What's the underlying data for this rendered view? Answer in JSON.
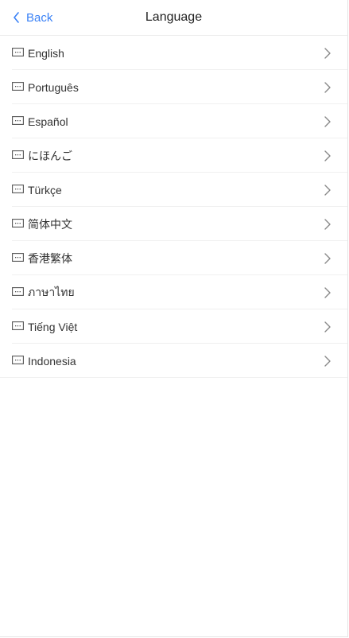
{
  "header": {
    "back_label": "Back",
    "title": "Language"
  },
  "colors": {
    "accent": "#3b82f6",
    "text": "#333333",
    "divider": "#f0f0f0",
    "chevron": "#888888"
  },
  "languages": [
    {
      "label": "English",
      "icon": "message-icon"
    },
    {
      "label": "Português",
      "icon": "message-icon"
    },
    {
      "label": "Español",
      "icon": "message-icon"
    },
    {
      "label": "にほんご",
      "icon": "message-icon"
    },
    {
      "label": "Türkçe",
      "icon": "message-icon"
    },
    {
      "label": "简体中文",
      "icon": "message-icon"
    },
    {
      "label": "香港繁体",
      "icon": "message-icon"
    },
    {
      "label": "ภาษาไทย",
      "icon": "message-icon"
    },
    {
      "label": "Tiếng Việt",
      "icon": "message-icon"
    },
    {
      "label": "Indonesia",
      "icon": "message-icon"
    }
  ]
}
